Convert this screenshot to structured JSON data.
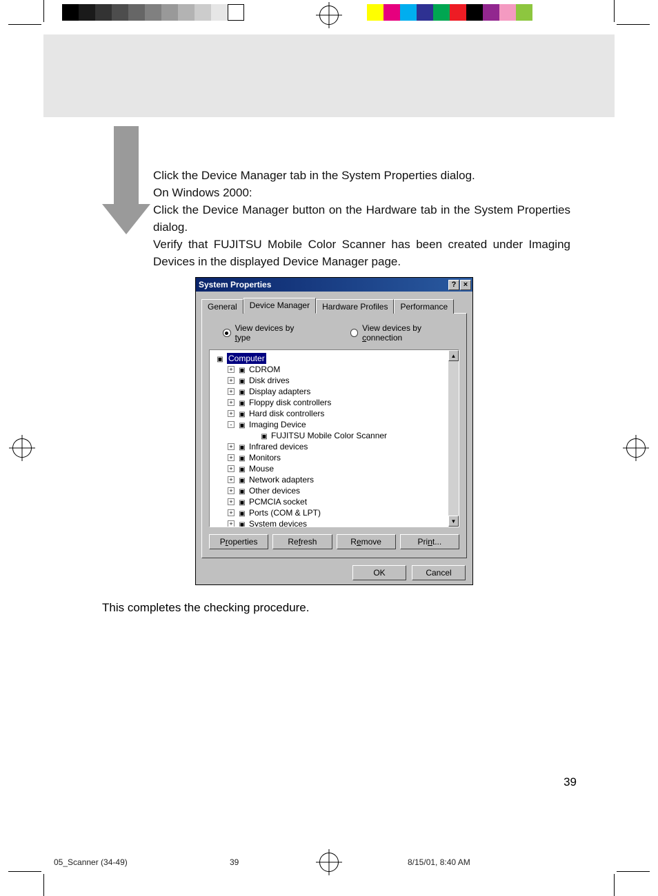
{
  "instructions": {
    "line1": "Click the Device Manager tab in the System Properties dialog.",
    "line2": "On Windows 2000:",
    "line3": "Click the Device Manager button on the Hardware tab in the System Properties dialog.",
    "line4": "Verify that FUJITSU Mobile Color Scanner has been created under Imaging Devices in the displayed Device Manager page."
  },
  "dialog": {
    "title": "System Properties",
    "tabs": [
      "General",
      "Device Manager",
      "Hardware Profiles",
      "Performance"
    ],
    "active_tab": "Device Manager",
    "radio1": "View devices by type",
    "radio2": "View devices by connection",
    "tree": [
      {
        "label": "Computer",
        "exp": null,
        "indent": 0,
        "selected": true
      },
      {
        "label": "CDROM",
        "exp": "+",
        "indent": 1
      },
      {
        "label": "Disk drives",
        "exp": "+",
        "indent": 1
      },
      {
        "label": "Display adapters",
        "exp": "+",
        "indent": 1
      },
      {
        "label": "Floppy disk controllers",
        "exp": "+",
        "indent": 1
      },
      {
        "label": "Hard disk controllers",
        "exp": "+",
        "indent": 1
      },
      {
        "label": "Imaging Device",
        "exp": "-",
        "indent": 1
      },
      {
        "label": "FUJITSU Mobile Color Scanner",
        "exp": null,
        "indent": 2
      },
      {
        "label": "Infrared devices",
        "exp": "+",
        "indent": 1
      },
      {
        "label": "Monitors",
        "exp": "+",
        "indent": 1
      },
      {
        "label": "Mouse",
        "exp": "+",
        "indent": 1
      },
      {
        "label": "Network adapters",
        "exp": "+",
        "indent": 1
      },
      {
        "label": "Other devices",
        "exp": "+",
        "indent": 1
      },
      {
        "label": "PCMCIA socket",
        "exp": "+",
        "indent": 1
      },
      {
        "label": "Ports (COM & LPT)",
        "exp": "+",
        "indent": 1
      },
      {
        "label": "System devices",
        "exp": "+",
        "indent": 1
      }
    ],
    "buttons": {
      "properties": "Properties",
      "refresh": "Refresh",
      "remove": "Remove",
      "print": "Print...",
      "ok": "OK",
      "cancel": "Cancel"
    }
  },
  "completes": "This completes the checking procedure.",
  "page_number": "39",
  "footer": {
    "file": "05_Scanner (34-49)",
    "page": "39",
    "datetime": "8/15/01, 8:40 AM"
  }
}
